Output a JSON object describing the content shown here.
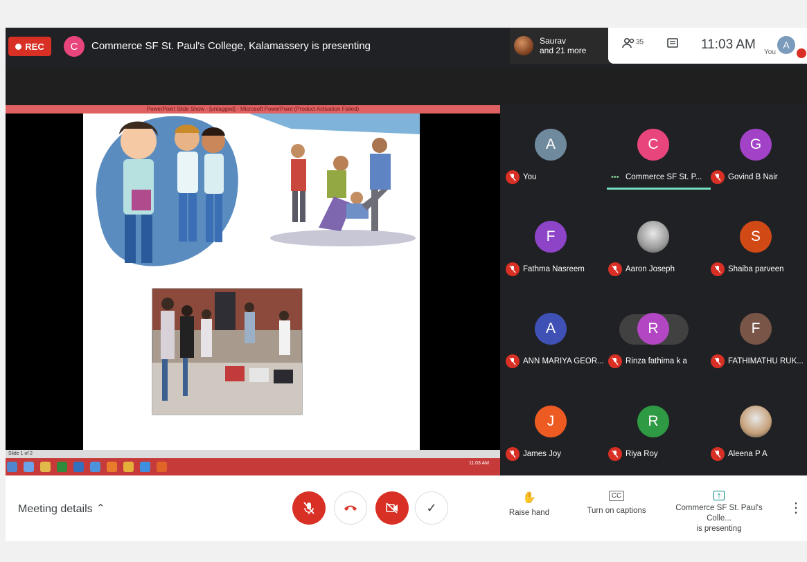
{
  "topbar": {
    "rec_label": "REC",
    "presenter_initial": "C",
    "presenting_text": "Commerce SF St. Paul's College, Kalamassery is presenting",
    "others_name": "Saurav",
    "others_more": "and 21 more",
    "people_count": "35",
    "clock": "11:03 AM",
    "you_label": "You",
    "self_initial": "A"
  },
  "participants": [
    {
      "initial": "A",
      "name": "You",
      "color": "#6f8a9c",
      "muted": true
    },
    {
      "initial": "C",
      "name": "Commerce SF St. P...",
      "color": "#e8457c",
      "muted": false,
      "speaking": true
    },
    {
      "initial": "G",
      "name": "Govind B Nair",
      "color": "#a142c7",
      "muted": true
    },
    {
      "initial": "F",
      "name": "Fathma Nasreem",
      "color": "#8e44c7",
      "muted": true
    },
    {
      "initial": "",
      "name": "Aaron Joseph",
      "color": "#9a9a9a",
      "muted": true,
      "photo": true
    },
    {
      "initial": "S",
      "name": "Shaiba parveen",
      "color": "#d14a16",
      "muted": true
    },
    {
      "initial": "A",
      "name": "ANN MARIYA GEOR...",
      "color": "#3f51b5",
      "muted": true
    },
    {
      "initial": "R",
      "name": "Rinza fathima k a",
      "color": "#b347c3",
      "muted": true,
      "pinbar": true
    },
    {
      "initial": "F",
      "name": "FATHIMATHU RUK...",
      "color": "#795548",
      "muted": true
    },
    {
      "initial": "J",
      "name": "James Joy",
      "color": "#ed5b22",
      "muted": true
    },
    {
      "initial": "R",
      "name": "Riya Roy",
      "color": "#2e9a43",
      "muted": true
    },
    {
      "initial": "",
      "name": "Aleena P A",
      "color": "#c6a079",
      "muted": true,
      "photo": true
    }
  ],
  "bottombar": {
    "meeting_details": "Meeting details",
    "raise_hand": "Raise hand",
    "captions": "Turn on captions",
    "presenting_line1": "Commerce SF St. Paul's Colle...",
    "presenting_line2": "is presenting"
  },
  "presentation": {
    "titlebar": "PowerPoint Slide Show - [untagged] - Microsoft PowerPoint (Product Activation Failed)",
    "status": "Slide 1 of 2",
    "tray_time": "11:03 AM"
  }
}
